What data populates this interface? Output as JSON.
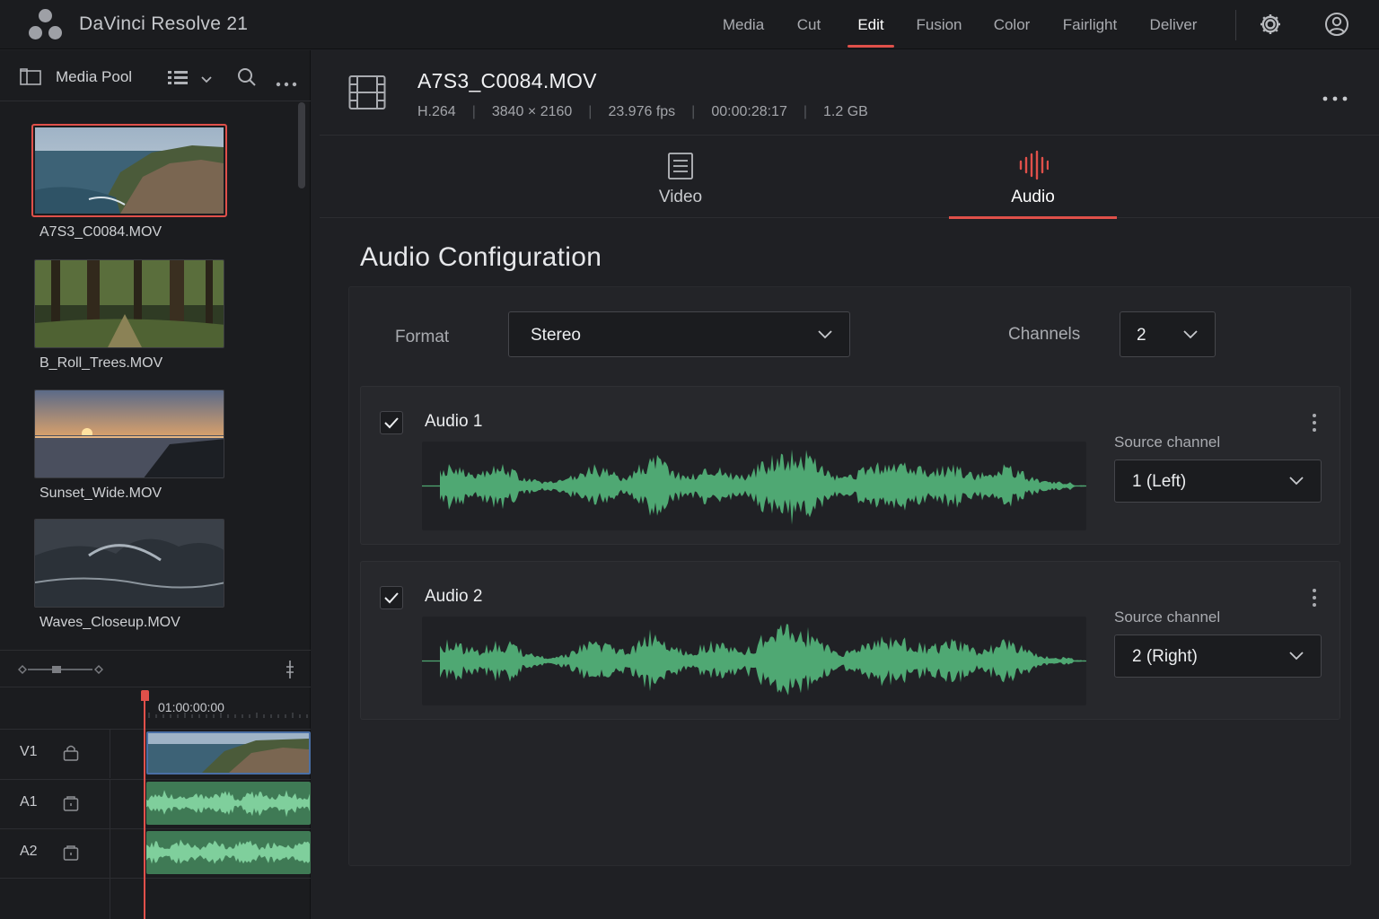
{
  "app": {
    "title": "DaVinci Resolve 21",
    "nav": [
      "Media",
      "Cut",
      "Edit",
      "Fusion",
      "Color",
      "Fairlight",
      "Deliver"
    ],
    "active_nav": "Edit",
    "accent_color": "#e0504a",
    "waveform_color": "#4fa873"
  },
  "media_pool": {
    "title": "Media Pool",
    "clips": [
      {
        "name": "A7S3_C0084.MOV",
        "selected": true
      },
      {
        "name": "B_Roll_Trees.MOV",
        "selected": false
      },
      {
        "name": "Sunset_Wide.MOV",
        "selected": false
      },
      {
        "name": "Waves_Closeup.MOV",
        "selected": false
      }
    ]
  },
  "timeline": {
    "timecode": "01:00:00:00",
    "tracks": [
      {
        "label": "V1",
        "icon": "lock-icon"
      },
      {
        "label": "A1",
        "icon": "lock-icon"
      },
      {
        "label": "A2",
        "icon": "lock-icon"
      }
    ]
  },
  "file": {
    "name": "A7S3_C0084.MOV",
    "codec": "H.264",
    "resolution": "3840 × 2160",
    "fps": "23.976 fps",
    "duration": "00:00:28:17",
    "size": "1.2 GB"
  },
  "tabs": [
    {
      "label": "Video",
      "icon": "document-icon",
      "active": false
    },
    {
      "label": "Audio",
      "icon": "waveform-icon",
      "active": true
    }
  ],
  "audio_config": {
    "title": "Audio Configuration",
    "format_label": "Format",
    "format_value": "Stereo",
    "channels_label": "Channels",
    "channels_value": "2",
    "tracks": [
      {
        "title": "Audio 1",
        "checked": true,
        "source_label": "Source channel",
        "source_value": "1 (Left)"
      },
      {
        "title": "Audio 2",
        "checked": true,
        "source_label": "Source channel",
        "source_value": "2 (Right)"
      }
    ]
  }
}
